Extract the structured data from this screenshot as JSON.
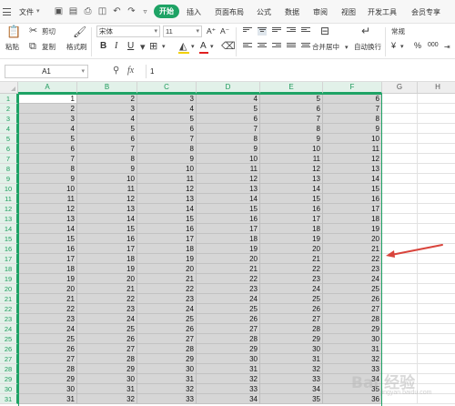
{
  "menubar": {
    "file_label": "文件",
    "tabs": [
      "开始",
      "插入",
      "页面布局",
      "公式",
      "数据",
      "审阅",
      "视图",
      "开发工具",
      "会员专享"
    ],
    "active_tab": "开始"
  },
  "ribbon": {
    "paste_label": "粘贴",
    "cut_label": "剪切",
    "copy_label": "复制",
    "format_painter_label": "格式刷",
    "font_name": "宋体",
    "font_size": "11",
    "bold": "B",
    "italic": "I",
    "underline": "U",
    "grow_font": "A⁺",
    "shrink_font": "A⁻",
    "merge_label": "合并居中",
    "wrap_label": "自动换行",
    "number_format": "常规",
    "currency_symbol": "¥",
    "percent_symbol": "%",
    "thousands_symbol": "000"
  },
  "formula_bar": {
    "name_box": "A1",
    "fx_label": "fx",
    "value": "1"
  },
  "sheet": {
    "columns": [
      "A",
      "B",
      "C",
      "D",
      "E",
      "F",
      "G",
      "H"
    ],
    "selected_columns": [
      "A",
      "B",
      "C",
      "D",
      "E",
      "F"
    ],
    "row_numbers": [
      1,
      2,
      3,
      4,
      5,
      6,
      7,
      8,
      9,
      10,
      11,
      12,
      13,
      14,
      15,
      16,
      17,
      18,
      19,
      20,
      21,
      22,
      23,
      24,
      25,
      26,
      27,
      28,
      29,
      30,
      31
    ],
    "rows": [
      [
        1,
        2,
        3,
        4,
        5,
        6
      ],
      [
        2,
        3,
        4,
        5,
        6,
        7
      ],
      [
        3,
        4,
        5,
        6,
        7,
        8
      ],
      [
        4,
        5,
        6,
        7,
        8,
        9
      ],
      [
        5,
        6,
        7,
        8,
        9,
        10
      ],
      [
        6,
        7,
        8,
        9,
        10,
        11
      ],
      [
        7,
        8,
        9,
        10,
        11,
        12
      ],
      [
        8,
        9,
        10,
        11,
        12,
        13
      ],
      [
        9,
        10,
        11,
        12,
        13,
        14
      ],
      [
        10,
        11,
        12,
        13,
        14,
        15
      ],
      [
        11,
        12,
        13,
        14,
        15,
        16
      ],
      [
        12,
        13,
        14,
        15,
        16,
        17
      ],
      [
        13,
        14,
        15,
        16,
        17,
        18
      ],
      [
        14,
        15,
        16,
        17,
        18,
        19
      ],
      [
        15,
        16,
        17,
        18,
        19,
        20
      ],
      [
        16,
        17,
        18,
        19,
        20,
        21
      ],
      [
        17,
        18,
        19,
        20,
        21,
        22
      ],
      [
        18,
        19,
        20,
        21,
        22,
        23
      ],
      [
        19,
        20,
        21,
        22,
        23,
        24
      ],
      [
        20,
        21,
        22,
        23,
        24,
        25
      ],
      [
        21,
        22,
        23,
        24,
        25,
        26
      ],
      [
        22,
        23,
        24,
        25,
        26,
        27
      ],
      [
        23,
        24,
        25,
        26,
        27,
        28
      ],
      [
        24,
        25,
        26,
        27,
        28,
        29
      ],
      [
        25,
        26,
        27,
        28,
        29,
        30
      ],
      [
        26,
        27,
        28,
        29,
        30,
        31
      ],
      [
        27,
        28,
        29,
        30,
        31,
        32
      ],
      [
        28,
        29,
        30,
        31,
        32,
        33
      ],
      [
        29,
        30,
        31,
        32,
        33,
        34
      ],
      [
        30,
        31,
        32,
        33,
        34,
        35
      ],
      [
        31,
        32,
        33,
        34,
        35,
        36
      ]
    ],
    "accent_color": "#1ea365",
    "annotation_arrow_color": "#d9443c"
  },
  "watermark": {
    "text": "Bai 经验",
    "sub": "jingyan.baidu.com"
  }
}
